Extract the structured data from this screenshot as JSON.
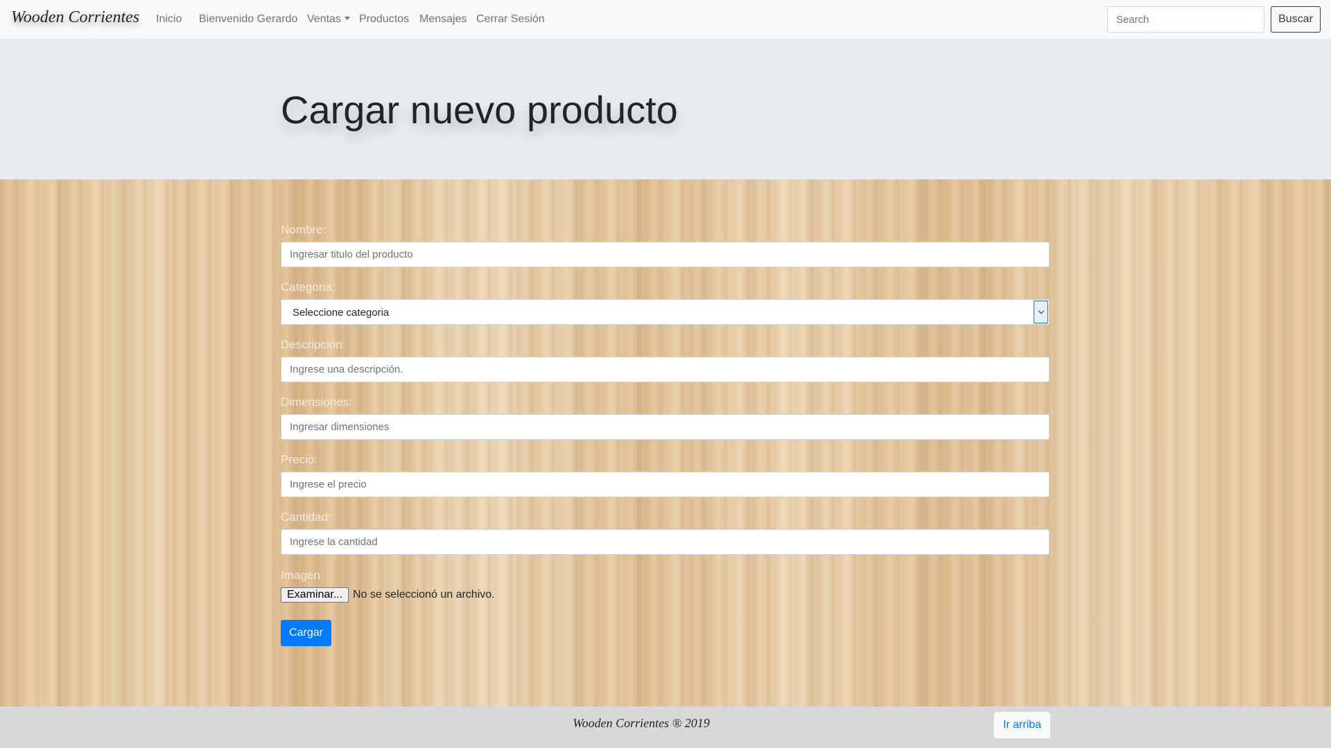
{
  "navbar": {
    "brand": "Wooden Corrientes",
    "links": [
      "Inicio",
      "Bienvenido Gerardo",
      "Ventas",
      "Productos",
      "Mensajes",
      "Cerrar Sesión"
    ],
    "search": {
      "placeholder": "Search",
      "value": ""
    },
    "search_button": "Buscar"
  },
  "header": {
    "title": "Cargar nuevo producto"
  },
  "form": {
    "nombre": {
      "label": "Nombre:",
      "placeholder": "Ingresar titulo del producto"
    },
    "categoria": {
      "label": "Categoria:",
      "selected": "Seleccione categoria"
    },
    "descripcion": {
      "label": "Descripcion:",
      "placeholder": "Ingrese una descripción."
    },
    "dimensiones": {
      "label": "Dimensiones:",
      "placeholder": "Ingresar dimensiones"
    },
    "precio": {
      "label": "Precio:",
      "placeholder": "Ingrese el precio"
    },
    "cantidad": {
      "label": "Cantidad:",
      "placeholder": "Ingrese la cantidad"
    },
    "imagen": {
      "label": "Imagen",
      "button": "Examinar...",
      "status": "No se seleccionó un archivo."
    },
    "submit": "Cargar"
  },
  "footer": {
    "text": "Wooden Corrientes ® 2019",
    "up_button": "Ir arriba"
  },
  "colors": {
    "primary": "#007bff",
    "navbar_bg": "#f8f9fa",
    "jumbotron_bg": "#e9ecef",
    "footer_bg": "#d8d8d8",
    "wood": "#e3c59d"
  }
}
